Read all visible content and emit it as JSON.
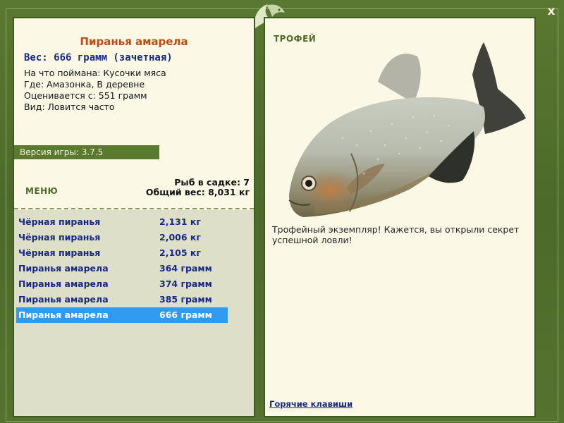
{
  "window": {
    "close_label": "x"
  },
  "catch": {
    "fish_name": "Пиранья амарела",
    "weight_line": "Вес: 666 грамм (зачетная)",
    "details": [
      "На что поймана: Кусочки мяса",
      "Где: Амазонка, В деревне",
      "Оценивается с: 551 грамм",
      "Вид: Ловится часто"
    ]
  },
  "version": "Версия игры: 3.7.5",
  "menu_label": "МЕНЮ",
  "stats": {
    "fish_in_cage": "Рыб в садке: 7",
    "total_weight": "Общий вес: 8,031 кг"
  },
  "fish_list": [
    {
      "name": "Чёрная пиранья",
      "weight": "2,131 кг",
      "selected": false
    },
    {
      "name": "Чёрная пиранья",
      "weight": "2,006 кг",
      "selected": false
    },
    {
      "name": "Чёрная пиранья",
      "weight": "2,105 кг",
      "selected": false
    },
    {
      "name": "Пиранья амарела",
      "weight": "364 грамм",
      "selected": false
    },
    {
      "name": "Пиранья амарела",
      "weight": "374 грамм",
      "selected": false
    },
    {
      "name": "Пиранья амарела",
      "weight": "385 грамм",
      "selected": false
    },
    {
      "name": "Пиранья амарела",
      "weight": "666 грамм",
      "selected": true
    }
  ],
  "trophy": {
    "label": "ТРОФЕЙ",
    "text": "Трофейный экземпляр! Кажется, вы открыли секрет успешной ловли!",
    "image_icon": "piranha-fish-image"
  },
  "hotkeys_label": "Горячие клавиши",
  "colors": {
    "frame": "#56722f",
    "panel": "#fbf9e6",
    "title": "#c24a12",
    "list_text": "#182a86",
    "selection": "#2f9af0"
  }
}
